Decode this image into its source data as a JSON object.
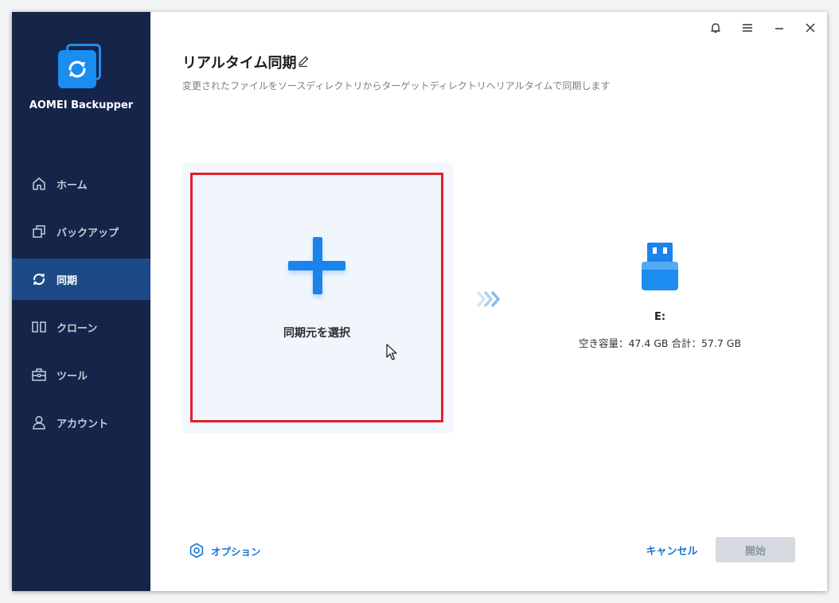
{
  "app": {
    "name": "AOMEI Backupper"
  },
  "sidebar": {
    "items": [
      {
        "label": "ホーム",
        "icon": "home-icon",
        "active": false
      },
      {
        "label": "バックアップ",
        "icon": "backup-icon",
        "active": false
      },
      {
        "label": "同期",
        "icon": "sync-icon",
        "active": true
      },
      {
        "label": "クローン",
        "icon": "clone-icon",
        "active": false
      },
      {
        "label": "ツール",
        "icon": "toolbox-icon",
        "active": false
      },
      {
        "label": "アカウント",
        "icon": "user-icon",
        "active": false
      }
    ]
  },
  "header": {
    "title": "リアルタイム同期",
    "subtitle": "変更されたファイルをソースディレクトリからターゲットディレクトリへリアルタイムで同期します"
  },
  "source": {
    "label": "同期元を選択"
  },
  "destination": {
    "drive": "E:",
    "space": "空き容量：47.4 GB 合計：57.7 GB"
  },
  "footer": {
    "options_label": "オプション",
    "cancel_label": "キャンセル",
    "start_label": "開始"
  },
  "colors": {
    "sidebar_bg": "#15254a",
    "sidebar_active": "#1d4a86",
    "accent": "#1a84ec",
    "highlight_border": "#e0202c",
    "disabled_button": "#d6dbe2"
  }
}
